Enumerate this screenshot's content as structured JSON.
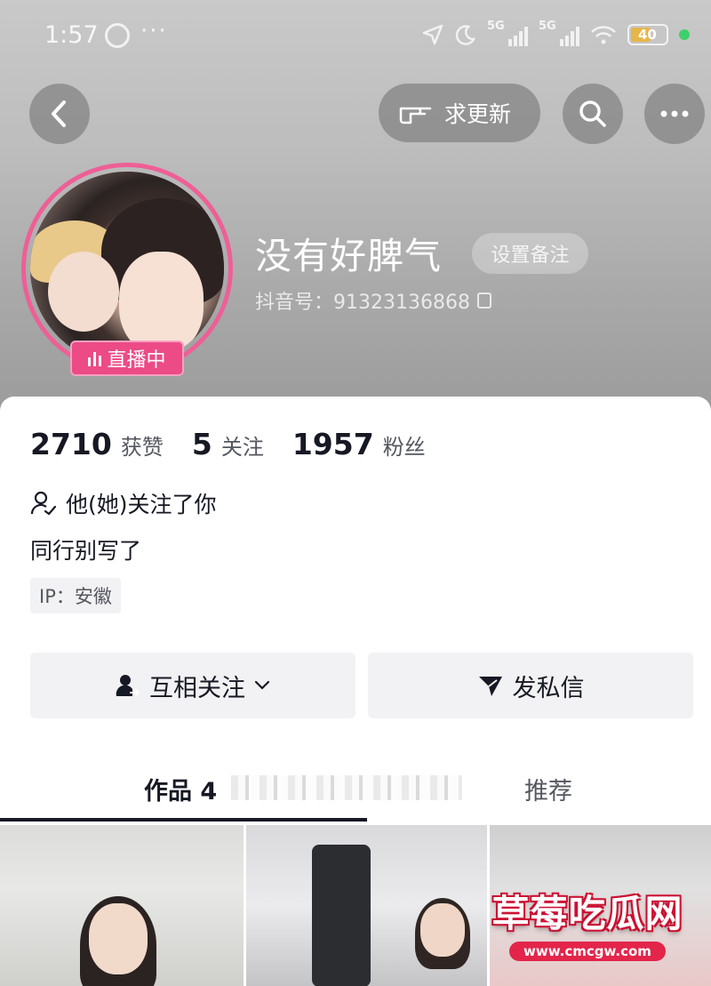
{
  "status_bar": {
    "time": "1:57",
    "more": "···",
    "net1": "5G",
    "net2": "5G",
    "battery": "40"
  },
  "nav": {
    "request_update_label": "求更新"
  },
  "profile": {
    "nickname": "没有好脾气",
    "set_remark_label": "设置备注",
    "douyin_id": "抖音号：91323136868",
    "live_badge": "直播中"
  },
  "stats": {
    "likes_count": "2710",
    "likes_label": "获赞",
    "following_count": "5",
    "following_label": "关注",
    "followers_count": "1957",
    "followers_label": "粉丝"
  },
  "follow_note": "他(她)关注了你",
  "bio": "同行别写了",
  "ip": "IP：安徽",
  "actions": {
    "mutual_follow": "互相关注",
    "message": "发私信"
  },
  "tabs": {
    "works": "作品 4",
    "recommend": "推荐"
  },
  "watermark": {
    "title": "草莓吃瓜网",
    "url": "www.cmcgw.com"
  },
  "colors": {
    "live_pink": "#ec4b86",
    "watermark_red": "#c8102e"
  }
}
